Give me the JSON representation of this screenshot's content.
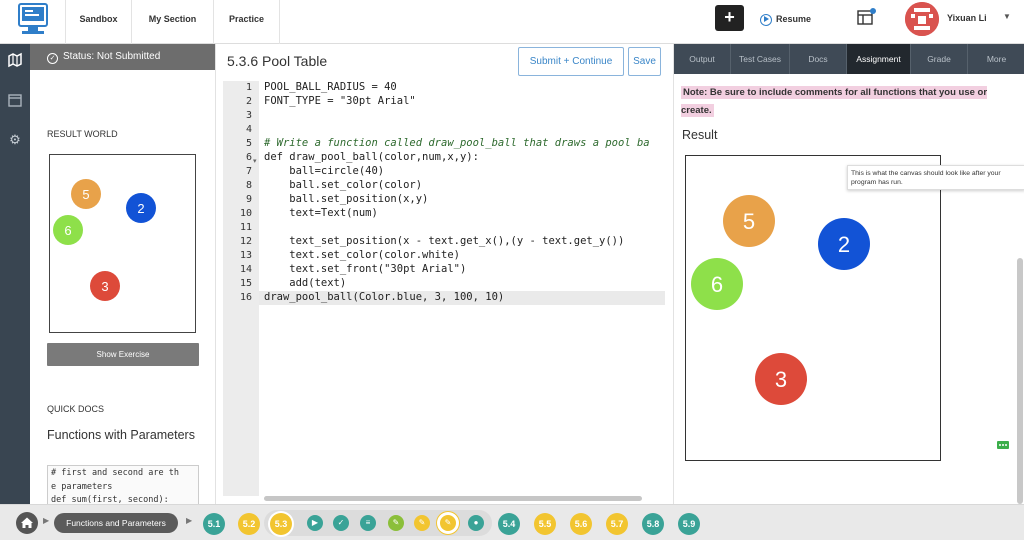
{
  "nav": {
    "sandbox": "Sandbox",
    "my_section": "My Section",
    "practice": "Practice",
    "plus": "+",
    "resume": "Resume",
    "user_name": "Yixuan Li"
  },
  "left": {
    "status": "Status: Not Submitted",
    "result_world_label": "RESULT WORLD",
    "show_exercise": "Show Exercise",
    "quick_docs_label": "QUICK DOCS",
    "quick_docs_title": "Functions with Parameters",
    "quick_docs_code": "# first and second are th\ne parameters\ndef sum(first, second):"
  },
  "editor": {
    "title": "5.3.6 Pool Table",
    "submit": "Submit + Continue",
    "save": "Save",
    "line_numbers": [
      "1",
      "2",
      "3",
      "4",
      "5",
      "6",
      "7",
      "8",
      "9",
      "10",
      "11",
      "12",
      "13",
      "14",
      "15",
      "16"
    ],
    "lines": [
      "POOL_BALL_RADIUS = 40",
      "FONT_TYPE = \"30pt Arial\"",
      "",
      "",
      "# Write a function called draw_pool_ball that draws a pool ba",
      "def draw_pool_ball(color,num,x,y):",
      "    ball=circle(40)",
      "    ball.set_color(color)",
      "    ball.set_position(x,y)",
      "    text=Text(num)",
      "",
      "    text_set_position(x - text.get_x(),(y - text.get_y())",
      "    text.set_color(color.white)",
      "    text.set_front(\"30pt Arial\")",
      "    add(text)",
      "draw_pool_ball(Color.blue, 3, 100, 10)"
    ]
  },
  "right": {
    "tabs": [
      "Output",
      "Test Cases",
      "Docs",
      "Assignment",
      "Grade",
      "More"
    ],
    "active_tab": "Assignment",
    "note": "Note: Be sure to include comments for all functions that you use or create.",
    "result_label": "Result",
    "tooltip": "This is what the canvas should look like after your program has run."
  },
  "balls": [
    {
      "num": "5",
      "color": "#e8a24a"
    },
    {
      "num": "2",
      "color": "#1253d6"
    },
    {
      "num": "6",
      "color": "#8ee04a"
    },
    {
      "num": "3",
      "color": "#dd4a3a"
    }
  ],
  "bottom": {
    "crumb": "Functions and Parameters",
    "units": [
      {
        "label": "5.1",
        "color": "#3aa397"
      },
      {
        "label": "5.2",
        "color": "#f2c530"
      },
      {
        "label": "5.3",
        "color": "#f2c530"
      },
      {
        "label": "5.4",
        "color": "#3aa397"
      },
      {
        "label": "5.5",
        "color": "#f2c530"
      },
      {
        "label": "5.6",
        "color": "#f2c530"
      },
      {
        "label": "5.7",
        "color": "#f2c530"
      },
      {
        "label": "5.8",
        "color": "#3aa397"
      },
      {
        "label": "5.9",
        "color": "#3aa397"
      }
    ],
    "activity_icons": [
      "video-icon",
      "check-icon",
      "doc-icon",
      "pencil-icon",
      "pencil-icon",
      "pencil-icon",
      "circle-icon"
    ]
  },
  "colors": {
    "accent": "#3a86c8",
    "rail": "#394551",
    "tab_bar": "#3f4a56",
    "teal": "#3aa397",
    "yellow": "#f2c530"
  }
}
